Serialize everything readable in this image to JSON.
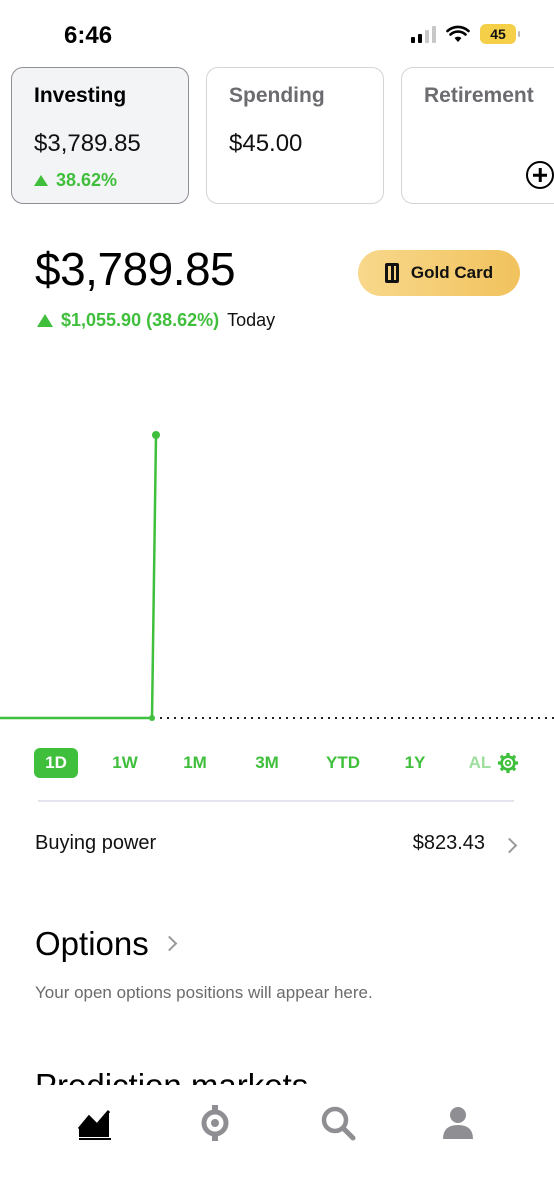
{
  "status_bar": {
    "time": "6:46",
    "battery": "45",
    "icons": [
      "signal-icon",
      "wifi-icon",
      "battery-icon"
    ]
  },
  "accounts": [
    {
      "name": "Investing",
      "value": "$3,789.85",
      "change": "38.62%",
      "active": true
    },
    {
      "name": "Spending",
      "value": "$45.00",
      "active": false
    },
    {
      "name": "Retirement",
      "active": false,
      "icon": "add-circle-icon"
    }
  ],
  "portfolio": {
    "value": "$3,789.85",
    "gain": "$1,055.90 (38.62%)",
    "period": "Today",
    "gold_button": "Gold Card"
  },
  "chart_data": {
    "type": "line",
    "series": [
      {
        "values": [
          0,
          0,
          1055.9
        ]
      }
    ],
    "baseline": 0,
    "color": "#3fbf3b",
    "grid": false,
    "dotted_baseline": true
  },
  "ranges": {
    "items": [
      "1D",
      "1W",
      "1M",
      "3M",
      "YTD",
      "1Y",
      "AL"
    ],
    "selected": "1D",
    "settings_icon": "gear-icon"
  },
  "buying_power": {
    "label": "Buying power",
    "value": "$823.43"
  },
  "options": {
    "title": "Options",
    "subtitle": "Your open options positions will appear here."
  },
  "prediction_markets": {
    "title": "Prediction markets"
  },
  "bottom_nav": {
    "items": [
      "chart-icon",
      "crypto-icon",
      "search-icon",
      "profile-icon"
    ]
  },
  "colors": {
    "accent": "#3fbf3b",
    "gold": "#f1c25d"
  }
}
